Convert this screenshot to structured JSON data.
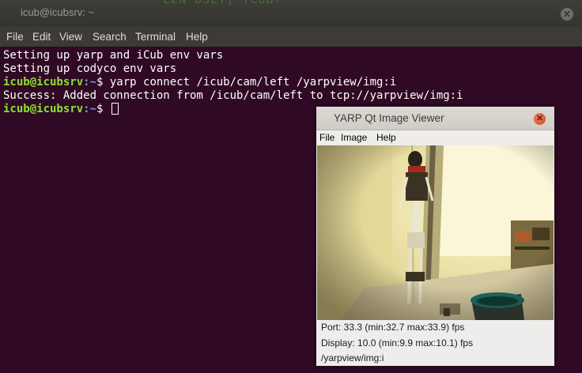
{
  "terminal": {
    "title": "icub@icubsrv: ~",
    "background_text": "EEN USET]  TCUBT",
    "menu": [
      "File",
      "Edit",
      "View",
      "Search",
      "Terminal",
      "Help"
    ],
    "lines": [
      {
        "text": "Setting up yarp and iCub env vars"
      },
      {
        "text": "Setting up codyco env vars"
      },
      {
        "user": "icub@icubsrv",
        "path": ":~",
        "cmd": "$ yarp connect /icub/cam/left /yarpview/img:i"
      },
      {
        "text": "Success: Added connection from /icub/cam/left to tcp://yarpview/img:i"
      },
      {
        "user": "icub@icubsrv",
        "path": ":~",
        "cmd": "$ "
      }
    ],
    "colors": {
      "background": "#300a24",
      "prompt_user": "#8ae234",
      "prompt_path": "#729fcf"
    }
  },
  "yarpview": {
    "title": "YARP Qt Image Viewer",
    "menu": [
      "File",
      "Image",
      "Help"
    ],
    "image_description": "camera-feed",
    "status": {
      "port": "Port: 33.3 (min:32.7 max:33.9) fps",
      "display": "Display: 10.0 (min:9.9 max:10.1) fps",
      "port_name": "/yarpview/img:i"
    }
  }
}
